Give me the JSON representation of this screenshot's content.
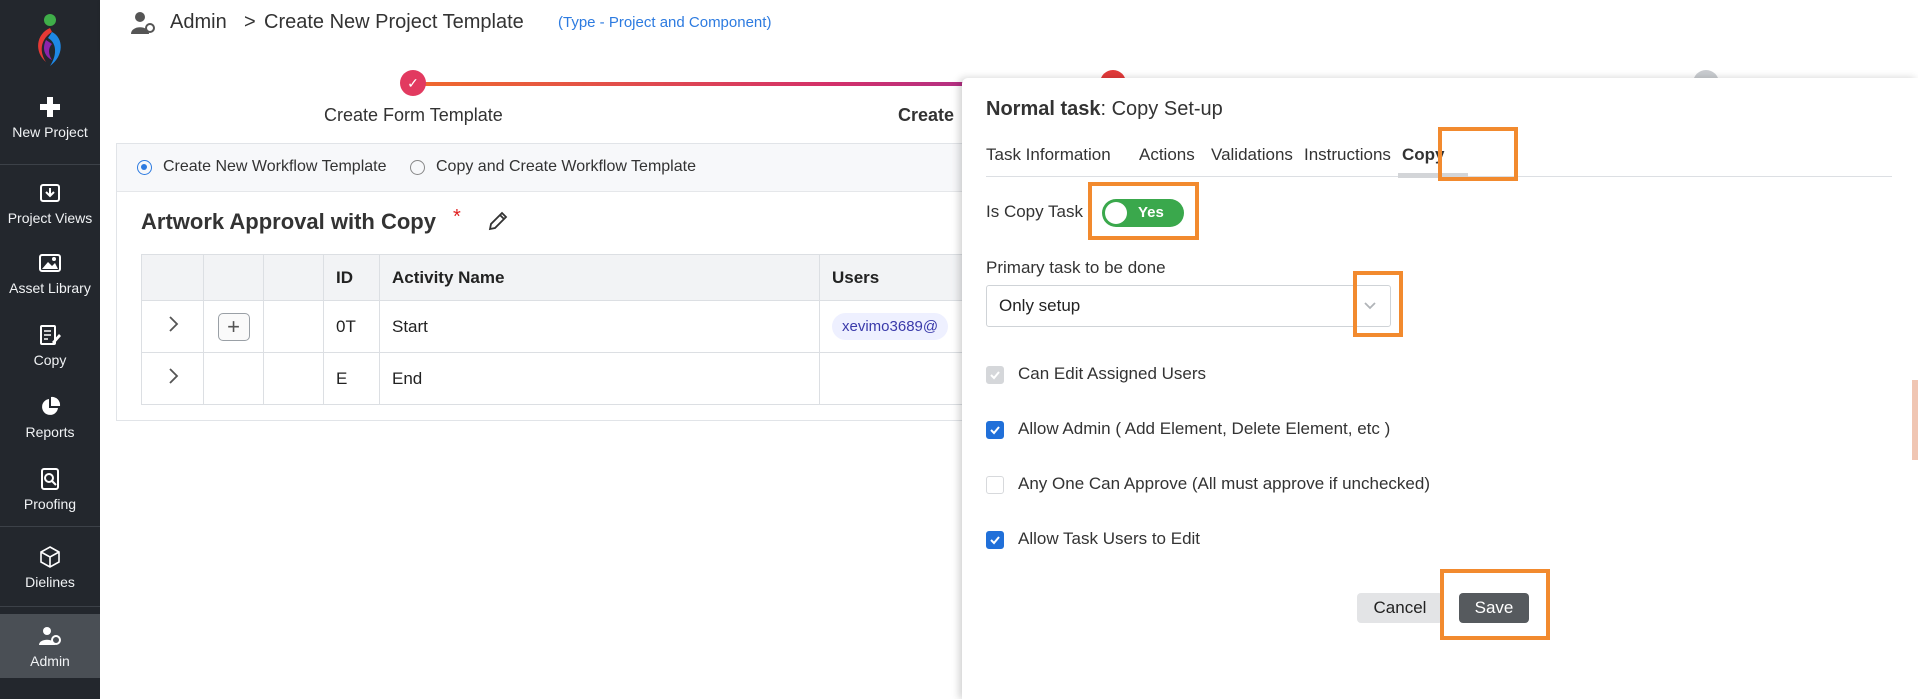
{
  "sidebar": {
    "items": [
      {
        "label": "New Project",
        "icon": "plus-icon"
      },
      {
        "label": "Project Views",
        "icon": "download-box-icon"
      },
      {
        "label": "Asset Library",
        "icon": "image-icon"
      },
      {
        "label": "Copy",
        "icon": "document-edit-icon"
      },
      {
        "label": "Reports",
        "icon": "pie-chart-icon"
      },
      {
        "label": "Proofing",
        "icon": "search-document-icon"
      },
      {
        "label": "Dielines",
        "icon": "cube-icon"
      },
      {
        "label": "Admin",
        "icon": "user-gear-icon"
      }
    ]
  },
  "header": {
    "crumb_root": "Admin",
    "separator": ">",
    "crumb_page": "Create New Project Template",
    "crumb_type": "(Type - Project and Component)"
  },
  "stepper": {
    "steps": [
      {
        "label": "Create Form Template"
      },
      {
        "label": "Create"
      }
    ]
  },
  "workflow": {
    "option_new": "Create New Workflow Template",
    "option_copy": "Copy and Create Workflow Template",
    "title": "Artwork Approval with Copy",
    "required_mark": "*",
    "columns": [
      "",
      "",
      "",
      "ID",
      "Activity Name",
      "Users"
    ],
    "rows": [
      {
        "id": "0T",
        "name": "Start",
        "user": "xevimo3689@"
      },
      {
        "id": "E",
        "name": "End",
        "user": ""
      }
    ]
  },
  "drawer": {
    "title_bold": "Normal task",
    "title_rest": ": Copy Set-up",
    "tabs": [
      "Task Information",
      "Actions",
      "Validations",
      "Instructions",
      "Copy"
    ],
    "active_tab": "Copy",
    "is_copy_label": "Is Copy Task",
    "toggle_text": "Yes",
    "primary_label": "Primary task to be done",
    "primary_value": "Only setup",
    "checkboxes": [
      {
        "label": "Can Edit Assigned Users",
        "state": "checked-disabled"
      },
      {
        "label": "Allow Admin ( Add Element, Delete Element, etc )",
        "state": "checked"
      },
      {
        "label": "Any One Can Approve (All must approve if unchecked)",
        "state": "unchecked"
      },
      {
        "label": "Allow Task Users to Edit",
        "state": "checked"
      }
    ],
    "cancel_label": "Cancel",
    "save_label": "Save"
  },
  "colors": {
    "sidebar_bg": "#23272d",
    "highlight": "#f28a2e",
    "toggle_on": "#3aa84c",
    "link_blue": "#2d7be0",
    "checkbox_blue": "#2170d9"
  }
}
